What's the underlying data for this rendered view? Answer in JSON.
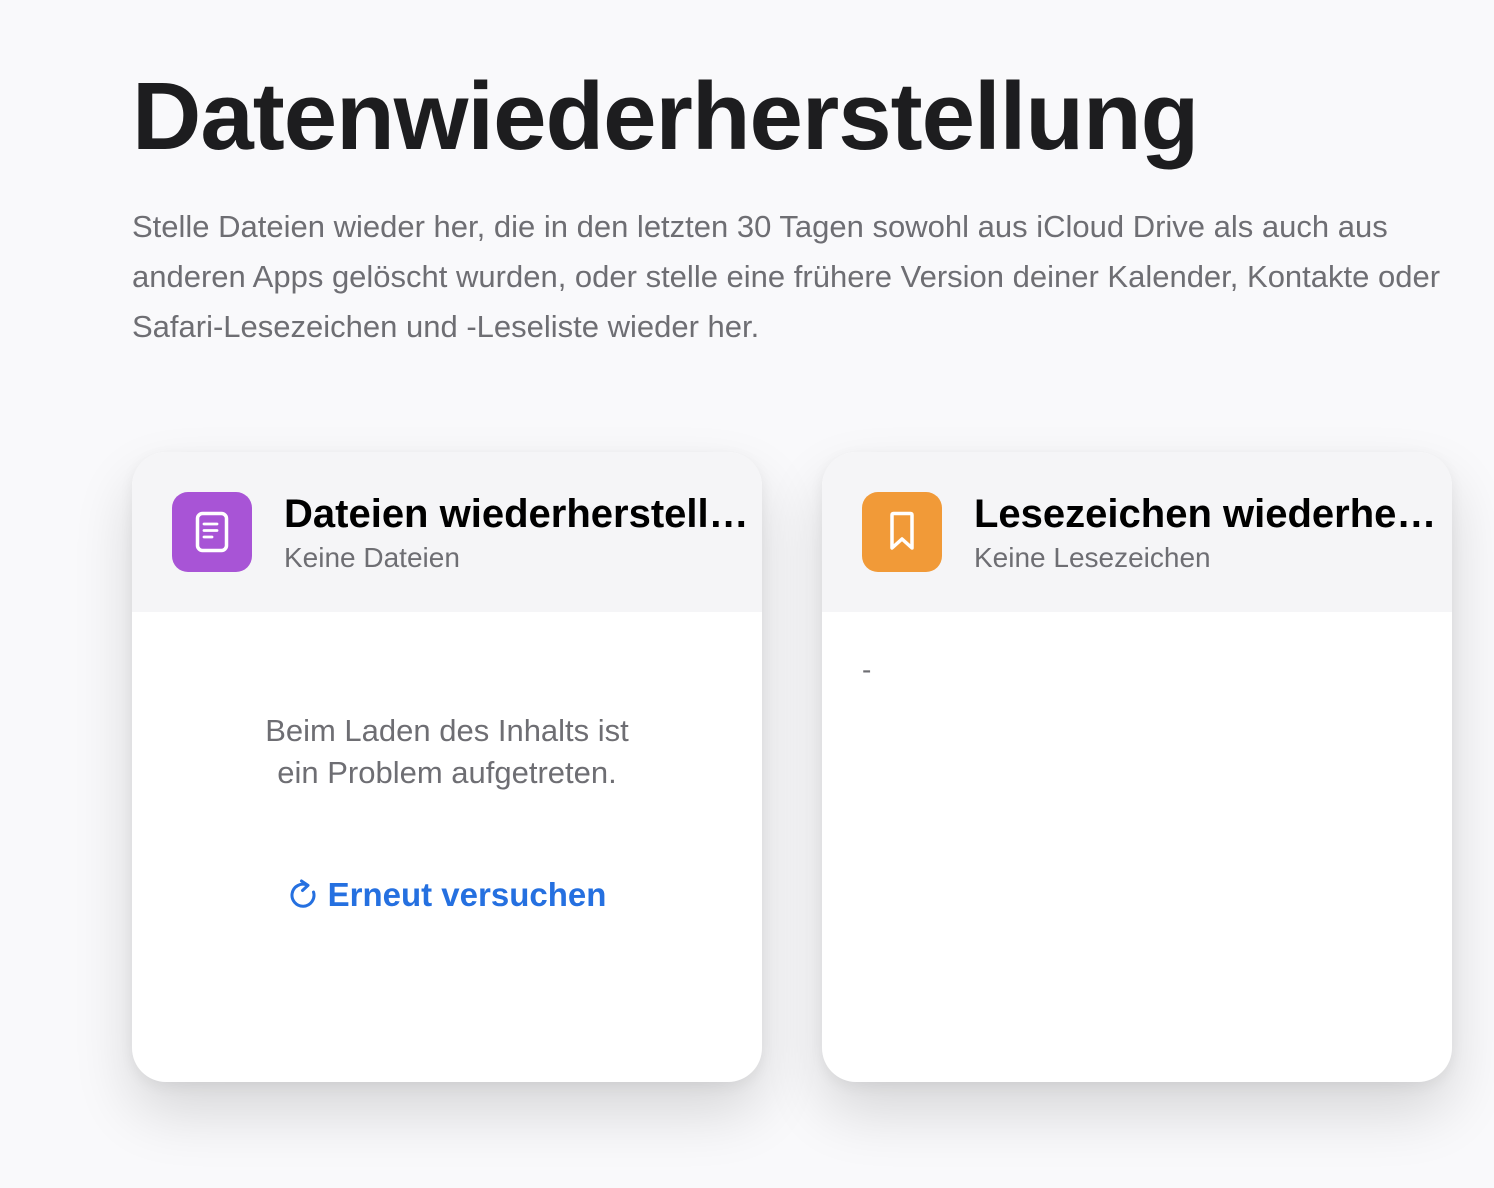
{
  "page": {
    "title": "Datenwiederherstellung",
    "description": "Stelle Dateien wieder her, die in den letzten 30 Tagen sowohl aus iCloud Drive als auch aus anderen Apps gelöscht wurden, oder stelle eine frühere Version deiner Kalender, Kontakte oder Safari-Lesezeichen und -Leseliste wieder her."
  },
  "cards": {
    "files": {
      "title": "Dateien wiederherstell…",
      "subtitle": "Keine Dateien",
      "icon": "document-icon",
      "icon_color": "#a854d6",
      "error_message": "Beim Laden des Inhalts ist ein Problem aufgetreten.",
      "retry_label": "Erneut versuchen",
      "retry_icon": "refresh-icon",
      "link_color": "#2570e0"
    },
    "bookmarks": {
      "title": "Lesezeichen wiederher…",
      "subtitle": "Keine Lesezeichen",
      "icon": "bookmark-icon",
      "icon_color": "#f19a38",
      "placeholder": "-"
    }
  }
}
